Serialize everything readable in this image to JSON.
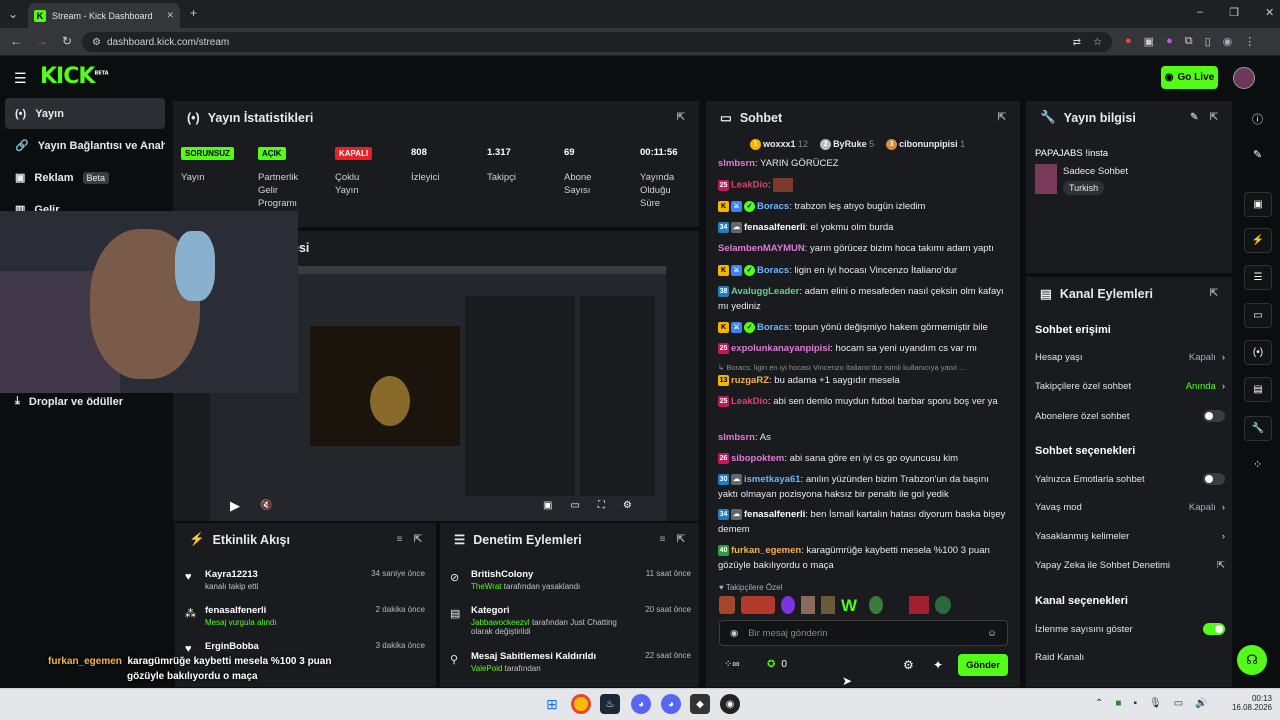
{
  "browser": {
    "tab_title": "Stream - Kick Dashboard",
    "url": "dashboard.kick.com/stream"
  },
  "header": {
    "logo": "KICK",
    "logo_sup": "BETA",
    "go_live": "Go Live"
  },
  "sidebar": {
    "items": [
      {
        "label": "Yayın"
      },
      {
        "label": "Yayın Bağlantısı ve Anahtar"
      },
      {
        "label": "Reklam",
        "badge": "Beta"
      },
      {
        "label": "Gelir"
      },
      {
        "label": "Droplar ve ödüller"
      }
    ]
  },
  "stats": {
    "title": "Yayın İstatistikleri",
    "cells": [
      {
        "value": "SORUNSUZ",
        "label": "Yayın"
      },
      {
        "value": "AÇIK",
        "label": "Partnerlik Gelir Programı"
      },
      {
        "value": "KAPALI",
        "label": "Çoklu Yayın"
      },
      {
        "value": "808",
        "label": "İzleyici"
      },
      {
        "value": "1.317",
        "label": "Takipçi"
      },
      {
        "value": "69",
        "label": "Abone Sayısı"
      },
      {
        "value": "00:11:56",
        "label": "Yayında Olduğu Süre"
      }
    ]
  },
  "preview": {
    "title_fragment": "esi"
  },
  "activity": {
    "title": "Etkinlik Akışı",
    "items": [
      {
        "name": "Kayra12213",
        "sub": "kanalı takip etti",
        "time": "34 saniye önce"
      },
      {
        "name": "fenasalfenerli",
        "sub": "Mesaj vurgula alındı",
        "time": "2 dakika önce"
      },
      {
        "name": "ErginBobba",
        "sub": "",
        "time": "3 dakika önce"
      }
    ]
  },
  "moderation": {
    "title": "Denetim Eylemleri",
    "items": [
      {
        "name": "BritishColony",
        "sub_user": "TheWrat",
        "sub": "tarafından yasaklandı",
        "time": "11 saat önce"
      },
      {
        "name": "Kategori",
        "sub_user": "Jabbawockeezvl",
        "sub": "tarafından Just Chatting olarak değiştirildi",
        "time": "20 saat önce"
      },
      {
        "name": "Mesaj Sabitlemesi Kaldırıldı",
        "sub_user": "ValePoid",
        "sub": "tarafından",
        "time": "22 saat önce"
      }
    ]
  },
  "chat": {
    "title": "Sohbet",
    "top": [
      {
        "name": "woxxx1",
        "count": "12"
      },
      {
        "name": "ByRuke",
        "count": "5"
      },
      {
        "name": "cibonunpipisi",
        "count": "1"
      }
    ],
    "messages": [
      {
        "user": "slmbsrn",
        "color": "#e07ad8",
        "text": "YARIN GÖRÜCEZ"
      },
      {
        "user": "LeakDio",
        "color": "#e0436a",
        "text": ""
      },
      {
        "user": "Boracs",
        "color": "#6cb5ff",
        "text": "trabzon leş atıyo bugün izledim"
      },
      {
        "user": "fenasalfenerli",
        "color": "#ffffff",
        "text": "el yokmu olm burda"
      },
      {
        "user": "SelambenMAYMUN",
        "color": "#e07ad8",
        "text": "yarın görücez bizim hoca takımı adam yaptı"
      },
      {
        "user": "Boracs",
        "color": "#6cb5ff",
        "text": "ligin en iyi hocası Vincenzo İtaliano'dur"
      },
      {
        "user": "AvaluggLeader",
        "color": "#5fd38a",
        "text": "adam elini o mesafeden nasıl çeksin olm kafayı mı yediniz"
      },
      {
        "user": "Boracs",
        "color": "#6cb5ff",
        "text": "topun yönü değişmiyo hakem görmemiştir bile"
      },
      {
        "user": "expolunkanayanpipisi",
        "color": "#e07ad8",
        "text": "hocam sa yeni uyandım cs var mı"
      },
      {
        "user": "Boracs",
        "color": "#8a8f93",
        "text": "ligin en iyi hocası Vincenzo İtaliano'dur isimli kullanıcıya yanıt ..."
      },
      {
        "user": "ruzgaRZ",
        "color": "#f3b24a",
        "text": "bu adama +1 saygıdır mesela"
      },
      {
        "user": "LeakDio",
        "color": "#e0436a",
        "text": "abi sen demlo muydun futbol barbar sporu boş ver ya"
      },
      {
        "user": "slmbsrn",
        "color": "#e07ad8",
        "text": "As"
      },
      {
        "user": "sibopoktem",
        "color": "#e07ad8",
        "text": "abi sana göre en iyi cs go oyuncusu kim"
      },
      {
        "user": "ismetkaya61",
        "color": "#6cb5ff",
        "text": "anılın yüzünden bizim Trabzon'un da başını yaktı olmayan pozisyona haksız bir penaltı ile gol yedik"
      },
      {
        "user": "fenasalfenerli",
        "color": "#ffffff",
        "text": "ben İsmail kartalın hatası diyorum baska bişey demem"
      },
      {
        "user": "furkan_egemen",
        "color": "#f3b24a",
        "text": "karagümrüğe kaybetti mesela %100 3 puan gözüyle bakılıyordu o maça"
      }
    ],
    "followers_only": "Takipçilere Özel",
    "input_placeholder": "Bir mesaj gönderin",
    "count": "0",
    "send": "Gönder"
  },
  "info": {
    "title": "Yayın bilgisi",
    "stream_title": "PAPAJABS !insta",
    "channel": "Sadece Sohbet",
    "tag": "Turkish"
  },
  "channel": {
    "title": "Kanal Eylemleri",
    "access": {
      "title": "Sohbet erişimi",
      "rows": [
        {
          "label": "Hesap yaşı",
          "value": "Kapalı"
        },
        {
          "label": "Takipçilere özel sohbet",
          "value": "Anında"
        },
        {
          "label": "Abonelere özel sohbet",
          "value": ""
        }
      ]
    },
    "options": {
      "title": "Sohbet seçenekleri",
      "rows": [
        {
          "label": "Yalnızca Emotlarla sohbet"
        },
        {
          "label": "Yavaş mod",
          "value": "Kapalı"
        },
        {
          "label": "Yasaklanmış kelimeler"
        },
        {
          "label": "Yapay Zeka ile Sohbet Denetimi"
        }
      ]
    },
    "channel_opts": {
      "title": "Kanal seçenekleri",
      "rows": [
        {
          "label": "İzlenme sayısını göster"
        },
        {
          "label": "Raid Kanalı"
        }
      ]
    }
  },
  "overlay": {
    "user": "furkan_egemen",
    "line1": "karagümrüğe kaybetti mesela %100 3 puan",
    "line2": "gözüyle bakılıyordu o maça"
  },
  "taskbar": {
    "time": "00:13",
    "date": "16.08.2026"
  }
}
